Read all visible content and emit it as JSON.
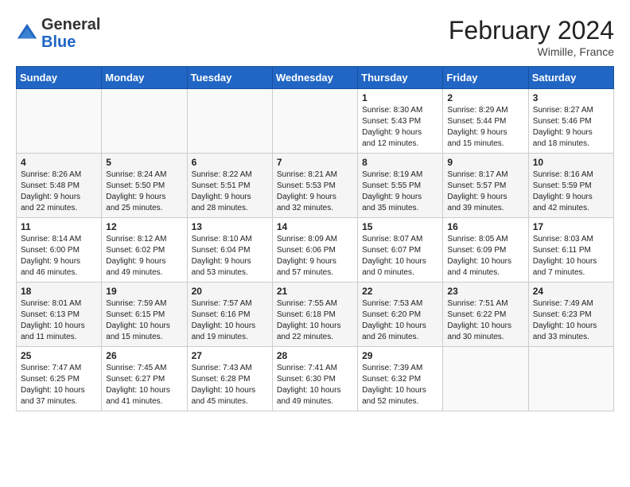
{
  "header": {
    "logo_general": "General",
    "logo_blue": "Blue",
    "month_year": "February 2024",
    "location": "Wimille, France"
  },
  "days_of_week": [
    "Sunday",
    "Monday",
    "Tuesday",
    "Wednesday",
    "Thursday",
    "Friday",
    "Saturday"
  ],
  "weeks": [
    [
      {
        "day": "",
        "info": ""
      },
      {
        "day": "",
        "info": ""
      },
      {
        "day": "",
        "info": ""
      },
      {
        "day": "",
        "info": ""
      },
      {
        "day": "1",
        "info": "Sunrise: 8:30 AM\nSunset: 5:43 PM\nDaylight: 9 hours\nand 12 minutes."
      },
      {
        "day": "2",
        "info": "Sunrise: 8:29 AM\nSunset: 5:44 PM\nDaylight: 9 hours\nand 15 minutes."
      },
      {
        "day": "3",
        "info": "Sunrise: 8:27 AM\nSunset: 5:46 PM\nDaylight: 9 hours\nand 18 minutes."
      }
    ],
    [
      {
        "day": "4",
        "info": "Sunrise: 8:26 AM\nSunset: 5:48 PM\nDaylight: 9 hours\nand 22 minutes."
      },
      {
        "day": "5",
        "info": "Sunrise: 8:24 AM\nSunset: 5:50 PM\nDaylight: 9 hours\nand 25 minutes."
      },
      {
        "day": "6",
        "info": "Sunrise: 8:22 AM\nSunset: 5:51 PM\nDaylight: 9 hours\nand 28 minutes."
      },
      {
        "day": "7",
        "info": "Sunrise: 8:21 AM\nSunset: 5:53 PM\nDaylight: 9 hours\nand 32 minutes."
      },
      {
        "day": "8",
        "info": "Sunrise: 8:19 AM\nSunset: 5:55 PM\nDaylight: 9 hours\nand 35 minutes."
      },
      {
        "day": "9",
        "info": "Sunrise: 8:17 AM\nSunset: 5:57 PM\nDaylight: 9 hours\nand 39 minutes."
      },
      {
        "day": "10",
        "info": "Sunrise: 8:16 AM\nSunset: 5:59 PM\nDaylight: 9 hours\nand 42 minutes."
      }
    ],
    [
      {
        "day": "11",
        "info": "Sunrise: 8:14 AM\nSunset: 6:00 PM\nDaylight: 9 hours\nand 46 minutes."
      },
      {
        "day": "12",
        "info": "Sunrise: 8:12 AM\nSunset: 6:02 PM\nDaylight: 9 hours\nand 49 minutes."
      },
      {
        "day": "13",
        "info": "Sunrise: 8:10 AM\nSunset: 6:04 PM\nDaylight: 9 hours\nand 53 minutes."
      },
      {
        "day": "14",
        "info": "Sunrise: 8:09 AM\nSunset: 6:06 PM\nDaylight: 9 hours\nand 57 minutes."
      },
      {
        "day": "15",
        "info": "Sunrise: 8:07 AM\nSunset: 6:07 PM\nDaylight: 10 hours\nand 0 minutes."
      },
      {
        "day": "16",
        "info": "Sunrise: 8:05 AM\nSunset: 6:09 PM\nDaylight: 10 hours\nand 4 minutes."
      },
      {
        "day": "17",
        "info": "Sunrise: 8:03 AM\nSunset: 6:11 PM\nDaylight: 10 hours\nand 7 minutes."
      }
    ],
    [
      {
        "day": "18",
        "info": "Sunrise: 8:01 AM\nSunset: 6:13 PM\nDaylight: 10 hours\nand 11 minutes."
      },
      {
        "day": "19",
        "info": "Sunrise: 7:59 AM\nSunset: 6:15 PM\nDaylight: 10 hours\nand 15 minutes."
      },
      {
        "day": "20",
        "info": "Sunrise: 7:57 AM\nSunset: 6:16 PM\nDaylight: 10 hours\nand 19 minutes."
      },
      {
        "day": "21",
        "info": "Sunrise: 7:55 AM\nSunset: 6:18 PM\nDaylight: 10 hours\nand 22 minutes."
      },
      {
        "day": "22",
        "info": "Sunrise: 7:53 AM\nSunset: 6:20 PM\nDaylight: 10 hours\nand 26 minutes."
      },
      {
        "day": "23",
        "info": "Sunrise: 7:51 AM\nSunset: 6:22 PM\nDaylight: 10 hours\nand 30 minutes."
      },
      {
        "day": "24",
        "info": "Sunrise: 7:49 AM\nSunset: 6:23 PM\nDaylight: 10 hours\nand 33 minutes."
      }
    ],
    [
      {
        "day": "25",
        "info": "Sunrise: 7:47 AM\nSunset: 6:25 PM\nDaylight: 10 hours\nand 37 minutes."
      },
      {
        "day": "26",
        "info": "Sunrise: 7:45 AM\nSunset: 6:27 PM\nDaylight: 10 hours\nand 41 minutes."
      },
      {
        "day": "27",
        "info": "Sunrise: 7:43 AM\nSunset: 6:28 PM\nDaylight: 10 hours\nand 45 minutes."
      },
      {
        "day": "28",
        "info": "Sunrise: 7:41 AM\nSunset: 6:30 PM\nDaylight: 10 hours\nand 49 minutes."
      },
      {
        "day": "29",
        "info": "Sunrise: 7:39 AM\nSunset: 6:32 PM\nDaylight: 10 hours\nand 52 minutes."
      },
      {
        "day": "",
        "info": ""
      },
      {
        "day": "",
        "info": ""
      }
    ]
  ]
}
